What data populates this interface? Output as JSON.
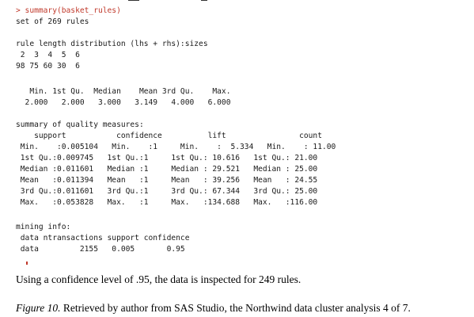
{
  "console": {
    "lines": [
      "> summary(basket_rules)",
      "set of 269 rules",
      "",
      "rule length distribution (lhs + rhs):sizes",
      " 2  3  4  5  6",
      "98 75 60 30  6",
      "",
      "   Min. 1st Qu.  Median    Mean 3rd Qu.    Max.",
      "  2.000   2.000   3.000   3.149   4.000   6.000",
      "",
      "summary of quality measures:",
      "    support           confidence          lift                count",
      " Min.    :0.005104   Min.    :1     Min.    :  5.334   Min.    : 11.00",
      " 1st Qu.:0.009745   1st Qu.:1     1st Qu.: 10.616   1st Qu.: 21.00",
      " Median :0.011601   Median :1     Median : 29.521   Median : 25.00",
      " Mean   :0.011394   Mean   :1     Mean   : 39.256   Mean   : 24.55",
      " 3rd Qu.:0.011601   3rd Qu.:1     3rd Qu.: 67.344   3rd Qu.: 25.00",
      " Max.   :0.053828   Max.   :1     Max.   :134.688   Max.   :116.00",
      "",
      "mining info:",
      " data ntransactions support confidence",
      " data         2155   0.005       0.95"
    ]
  },
  "text": {
    "body": "Using a confidence level of .95, the data is inspected for 249 rules.",
    "figure_label": "Figure 10.",
    "figure_caption": " Retrieved by author from SAS Studio, the Northwind data cluster analysis 4 of 7."
  }
}
